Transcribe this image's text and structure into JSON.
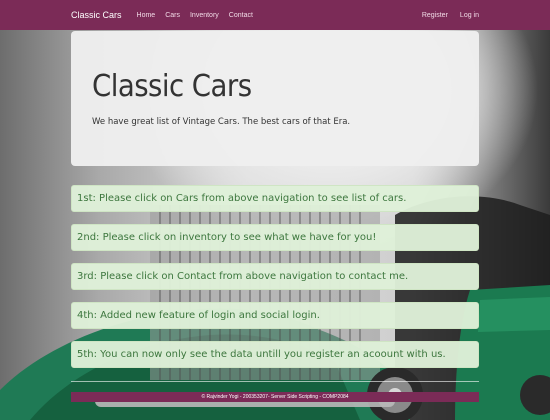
{
  "nav": {
    "brand": "Classic Cars",
    "links": [
      "Home",
      "Cars",
      "Inventory",
      "Contact"
    ],
    "right_links": [
      "Register",
      "Log in"
    ]
  },
  "jumbotron": {
    "title": "Classic Cars",
    "subtitle": "We have great list of Vintage Cars. The best cars of that Era."
  },
  "steps": [
    "1st: Please click on Cars from above navigation to see list of cars.",
    "2nd: Please click on inventory to see what we have for you!",
    "3rd: Please click on Contact from above navigation to contact me.",
    "4th: Added new feature of login and social login.",
    "5th: You can now only see the data untill you register an acoount with us."
  ],
  "footer": {
    "text": "© Rajvinder Yogi - 200353207- Server Side Scripting - COMP2084"
  },
  "colors": {
    "navbar": "#7b2b57",
    "step_bg": "#dff0d8",
    "step_text": "#3c763d"
  }
}
